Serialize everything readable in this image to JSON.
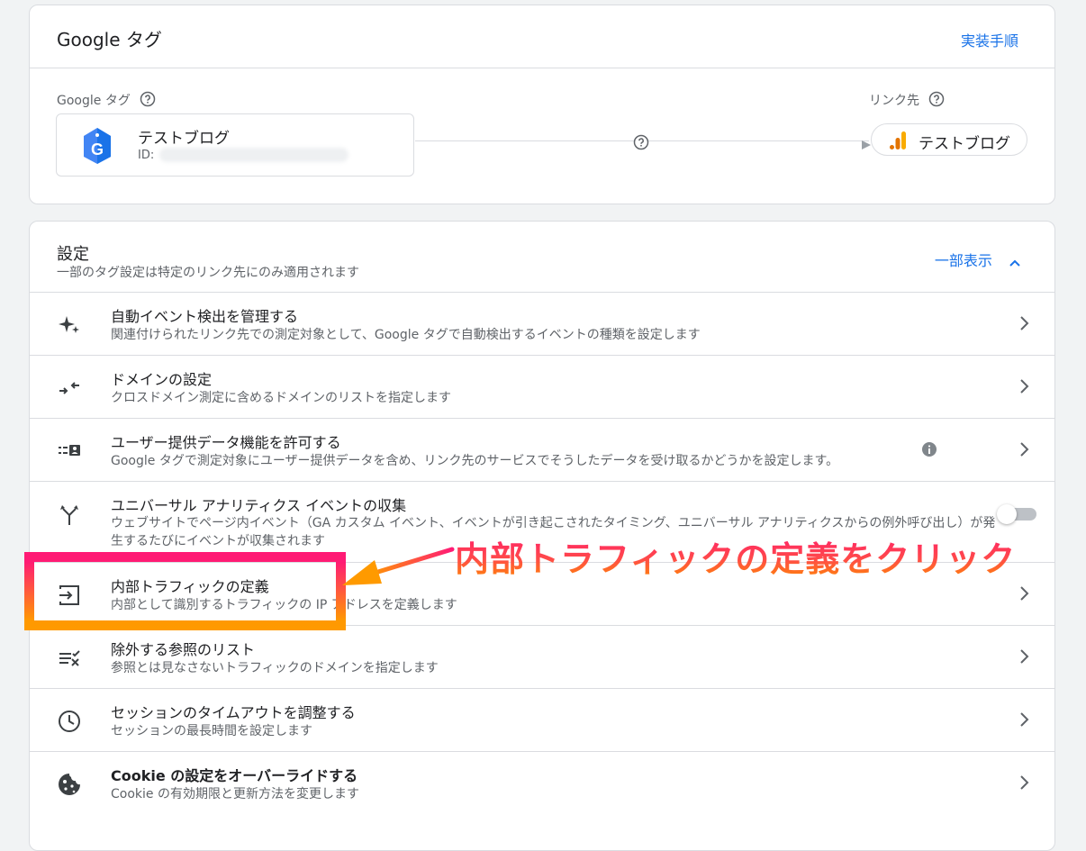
{
  "tag_card": {
    "title": "Google タグ",
    "impl_link": "実装手順",
    "tag_label": "Google タグ",
    "dest_label": "リンク先",
    "tag_name": "テストブログ",
    "tag_id_prefix": "ID:",
    "dest_name": "テストブログ"
  },
  "settings": {
    "title": "設定",
    "subtitle": "一部のタグ設定は特定のリンク先にのみ適用されます",
    "partial_label": "一部表示",
    "items": [
      {
        "title": "自動イベント検出を管理する",
        "desc": "関連付けられたリンク先での測定対象として、Google タグで自動検出するイベントの種類を設定します",
        "icon": "sparkle-icon"
      },
      {
        "title": "ドメインの設定",
        "desc": "クロスドメイン測定に含めるドメインのリストを指定します",
        "icon": "merge-arrows-icon"
      },
      {
        "title": "ユーザー提供データ機能を許可する",
        "desc": "Google タグで測定対象にユーザー提供データを含め、リンク先のサービスでそうしたデータを受け取るかどうかを設定します。",
        "icon": "user-data-icon"
      },
      {
        "title": "ユニバーサル アナリティクス イベントの収集",
        "desc": "ウェブサイトでページ内イベント（GA カスタム イベント、イベントが引き起こされたタイミング、ユニバーサル アナリティクスからの例外呼び出し）が発生するたびにイベントが収集されます",
        "icon": "fork-icon",
        "toggle_on": false
      },
      {
        "title": "内部トラフィックの定義",
        "desc": "内部として識別するトラフィックの IP アドレスを定義します",
        "icon": "login-icon"
      },
      {
        "title": "除外する参照のリスト",
        "desc": "参照とは見なさないトラフィックのドメインを指定します",
        "icon": "list-exclude-icon"
      },
      {
        "title": "セッションのタイムアウトを調整する",
        "desc": "セッションの最長時間を設定します",
        "icon": "clock-icon"
      },
      {
        "title": "Cookie の設定をオーバーライドする",
        "desc": "Cookie の有効期限と更新方法を変更します",
        "icon": "cookie-icon"
      }
    ]
  },
  "annotation": {
    "text": "内部トラフィックの定義をクリック"
  },
  "colors": {
    "accent": "#1a73e8",
    "annotation_pink": "#ff1a75",
    "annotation_orange": "#ff9a00"
  }
}
